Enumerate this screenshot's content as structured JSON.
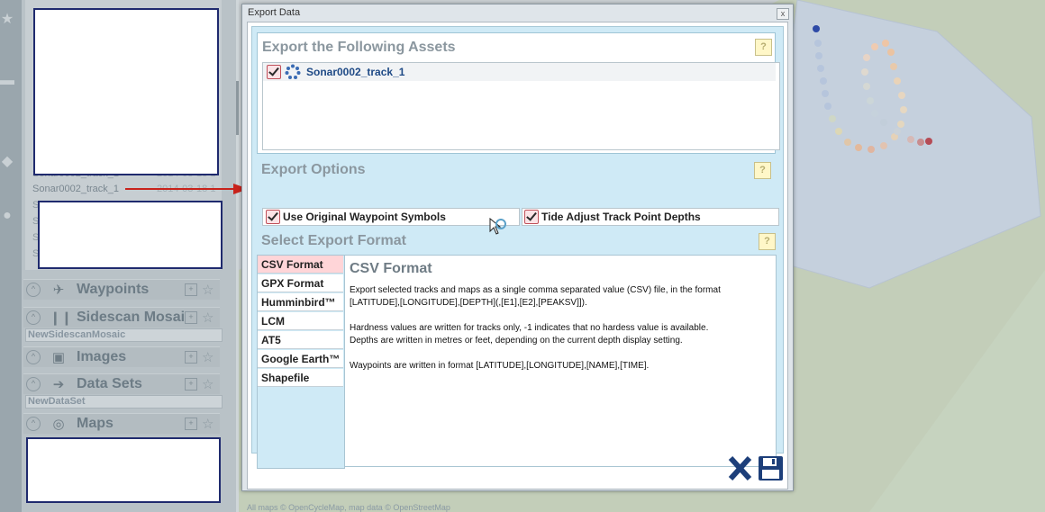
{
  "left_panel": {
    "tracks": [
      {
        "name": "Sonar0002_track_1",
        "date": "2014-03-18 1"
      },
      {
        "name": "Sonar0002_track_1",
        "date": "2014-03-18 1"
      }
    ],
    "sections": [
      {
        "title": "Waypoints",
        "icon": "pin-icon",
        "sub": ""
      },
      {
        "title": "Sidescan Mosai",
        "icon": "sonar-icon",
        "sub": "NewSidescanMosaic"
      },
      {
        "title": "Images",
        "icon": "image-icon",
        "sub": ""
      },
      {
        "title": "Data Sets",
        "icon": "arrow-right-icon",
        "sub": "NewDataSet"
      },
      {
        "title": "Maps",
        "icon": "radar-icon",
        "sub": ""
      }
    ]
  },
  "map": {
    "attribution": "All maps © OpenCycleMap, map data © OpenStreetMap"
  },
  "dialog": {
    "title": "Export Data",
    "close_label": "x",
    "assets_heading": "Export the Following Assets",
    "help_label": "?",
    "assets": [
      {
        "name": "Sonar0002_track_1",
        "checked": true
      }
    ],
    "options_heading": "Export Options",
    "options": [
      {
        "label": "Use Original Waypoint Symbols",
        "checked": true
      },
      {
        "label": "Tide Adjust Track Point Depths",
        "checked": true
      }
    ],
    "format_heading": "Select Export Format",
    "formats": [
      "CSV Format",
      "GPX Format",
      "Humminbird™",
      "LCM",
      "AT5",
      "Google Earth™",
      "Shapefile"
    ],
    "selected_format": "CSV Format",
    "description": {
      "title": "CSV Format",
      "p1": "Export selected tracks and maps as a single comma separated value (CSV) file, in the format [LATITUDE],[LONGITUDE],[DEPTH](,[E1],[E2],[PEAKSV]]).",
      "p2": "Hardness values are written for tracks only, -1 indicates that no hardess value is available.",
      "p3": "Depths are written in metres or feet, depending on the current depth display setting.",
      "p4": "Waypoints are written in format [LATITUDE],[LONGITUDE],[NAME],[TIME]."
    },
    "footer": {
      "cancel_icon": "close-x-icon",
      "save_icon": "save-disk-icon"
    }
  },
  "colors": {
    "accent_blue": "#1f4a86",
    "selected_format_bg": "#ffd5d8",
    "callout_arrow": "#c8231c",
    "help_bg": "#fff7c8"
  }
}
